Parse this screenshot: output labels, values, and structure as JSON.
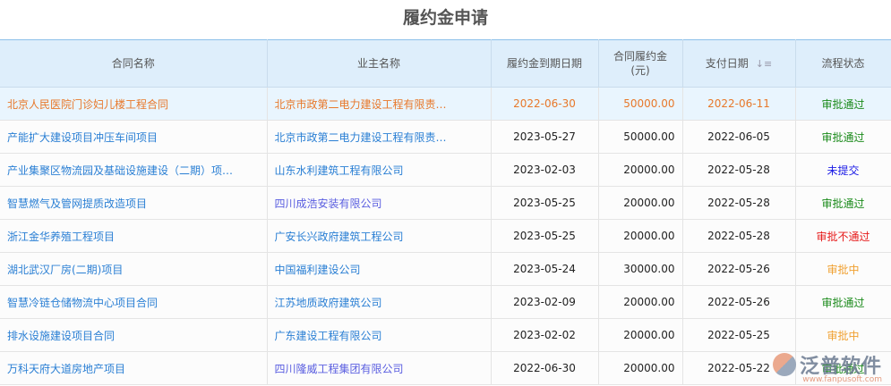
{
  "title": "履约金申请",
  "columns": [
    "合同名称",
    "业主名称",
    "履约金到期日期",
    "合同履约金",
    "(元)",
    "支付日期",
    "流程状态"
  ],
  "sort_icon": "sort-icon",
  "rows": [
    {
      "contract": "北京人民医院门诊妇儿楼工程合同",
      "owner": "北京市政第二电力建设工程有限责…",
      "due": "2022-06-30",
      "amount": "50000.00",
      "paid": "2022-06-11",
      "status": "审批通过",
      "status_color": "#1a8a1a",
      "owner_color": "#e8782a"
    },
    {
      "contract": "产能扩大建设项目冲压车间项目",
      "owner": "北京市政第二电力建设工程有限责…",
      "due": "2023-05-27",
      "amount": "50000.00",
      "paid": "2022-06-05",
      "status": "审批通过",
      "status_color": "#1a8a1a",
      "owner_color": "#2a7fd4"
    },
    {
      "contract": "产业集聚区物流园及基础设施建设（二期）项…",
      "owner": "山东水利建筑工程有限公司",
      "due": "2023-02-03",
      "amount": "20000.00",
      "paid": "2022-05-28",
      "status": "未提交",
      "status_color": "#1a1ae6",
      "owner_color": "#2a7fd4"
    },
    {
      "contract": "智慧燃气及管网提质改造项目",
      "owner": "四川成浩安装有限公司",
      "due": "2023-05-25",
      "amount": "20000.00",
      "paid": "2022-05-28",
      "status": "审批通过",
      "status_color": "#1a8a1a",
      "owner_color": "#5a5ee0"
    },
    {
      "contract": "浙江金华养殖工程项目",
      "owner": "广安长兴政府建筑工程公司",
      "due": "2023-05-25",
      "amount": "20000.00",
      "paid": "2022-05-28",
      "status": "审批不通过",
      "status_color": "#e61a1a",
      "owner_color": "#2a7fd4"
    },
    {
      "contract": "湖北武汉厂房(二期)项目",
      "owner": "中国福利建设公司",
      "due": "2023-05-24",
      "amount": "30000.00",
      "paid": "2022-05-26",
      "status": "审批中",
      "status_color": "#f0a030",
      "owner_color": "#2a7fd4"
    },
    {
      "contract": "智慧冷链仓储物流中心项目合同",
      "owner": "江苏地质政府建筑公司",
      "due": "2023-02-09",
      "amount": "20000.00",
      "paid": "2022-05-26",
      "status": "审批通过",
      "status_color": "#1a8a1a",
      "owner_color": "#2a7fd4"
    },
    {
      "contract": "排水设施建设项目合同",
      "owner": "广东建设工程有限公司",
      "due": "2023-02-02",
      "amount": "20000.00",
      "paid": "2022-05-25",
      "status": "审批中",
      "status_color": "#f0a030",
      "owner_color": "#2a7fd4"
    },
    {
      "contract": "万科天府大道房地产项目",
      "owner": "四川隆威工程集团有限公司",
      "due": "2022-06-30",
      "amount": "20000.00",
      "paid": "2022-05-22",
      "status": "审批通过",
      "status_color": "#1a8a1a",
      "owner_color": "#5a5ee0"
    }
  ],
  "watermark": {
    "name": "泛普软件",
    "url": "www.fanpusoft.com"
  }
}
